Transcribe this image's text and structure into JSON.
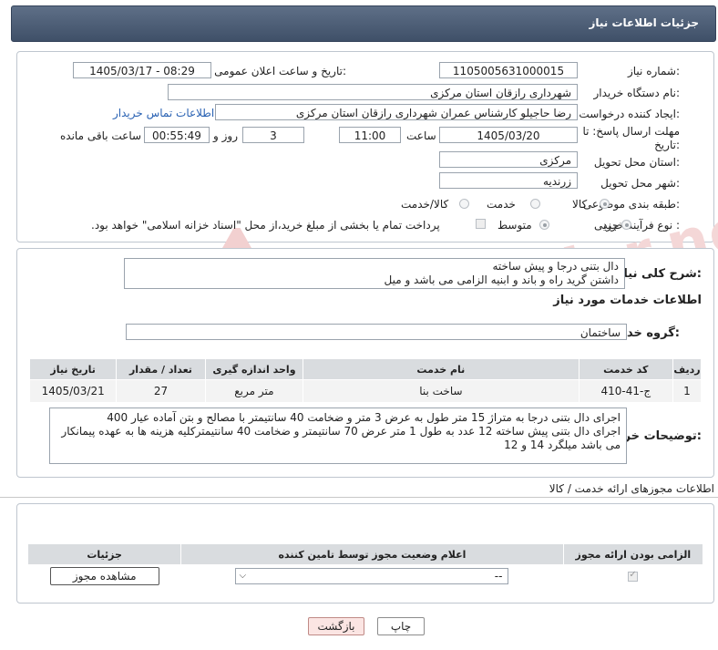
{
  "header": {
    "title": "جزئیات اطلاعات نیاز"
  },
  "form": {
    "need_number_label": "شماره نیاز:",
    "need_number": "1105005631000015",
    "announce_label": "تاریخ و ساعت اعلان عمومی:",
    "announce_value": "1405/03/17 - 08:29",
    "buyer_org_label": "نام دستگاه خریدار:",
    "buyer_org": "شهرداری رازقان استان مرکزی",
    "creator_label": "ایجاد کننده درخواست:",
    "creator": "رضا حاجیلو کارشناس عمران شهرداری رازقان استان مرکزی",
    "contact_link": "اطلاعات تماس خریدار",
    "deadline_label_1": "مهلت ارسال پاسخ: تا",
    "deadline_label_2": "تاریخ:",
    "deadline_date": "1405/03/20",
    "time_label": "ساعت",
    "deadline_time": "11:00",
    "days_value": "3",
    "days_label": "روز و",
    "remaining_value": "00:55:49",
    "remaining_label": "ساعت باقی مانده",
    "province_label": "استان محل تحویل:",
    "province": "مرکزی",
    "city_label": "شهر محل تحویل:",
    "city": "زرندیه",
    "category_label": "طبقه بندی موضوعی:",
    "category_options": [
      "کالا",
      "خدمت",
      "کالا/خدمت"
    ],
    "category_selected": "کالا",
    "process_label": "نوع فرآیند خرید :",
    "process_options": [
      "جزیی",
      "متوسط"
    ],
    "process_selected": "جزیی",
    "payment_note": "پرداخت تمام یا بخشی از مبلغ خرید،از محل \"اسناد خزانه اسلامی\" خواهد بود."
  },
  "summary": {
    "label": "شرح کلی نیاز:",
    "line1": "دال بتنی درجا و پیش ساخته",
    "line2": "داشتن گرید راه و باند و ابنیه الزامی می باشد و میل"
  },
  "services": {
    "section_title": "اطلاعات خدمات مورد نیاز",
    "group_label": "گروه خدمت:",
    "group_value": "ساختمان",
    "columns": [
      "ردیف",
      "کد خدمت",
      "نام خدمت",
      "واحد اندازه گیری",
      "تعداد / مقدار",
      "تاریخ نیاز"
    ],
    "rows": [
      {
        "row": "1",
        "code": "ج-41-410",
        "name": "ساخت بنا",
        "unit": "متر مربع",
        "qty": "27",
        "date": "1405/03/21"
      }
    ]
  },
  "buyer_notes": {
    "label": "توضیحات خریدار:",
    "line1": "اجرای دال بتنی درجا به متراژ 15 متر طول به عرض 3 متر و ضخامت 40 سانتیمتر با مصالح و بتن آماده عیار 400",
    "line2": "اجرای دال بتنی پیش ساخته 12 عدد به طول 1 متر عرض 70 سانتیمتر و ضخامت 40 سانتیمترکلیه هزینه ها به عهده پیمانکار",
    "line3": "می باشد میلگرد 14 و 12"
  },
  "permits": {
    "section_title": "اطلاعات مجوزهای ارائه خدمت / کالا",
    "columns": [
      "الزامی بودن ارائه مجوز",
      "اعلام وضعیت مجوز توسط تامین کننده",
      "جزئیات"
    ],
    "select_value": "--",
    "view_button": "مشاهده مجوز"
  },
  "footer": {
    "print_button": "چاپ",
    "back_button": "بازگشت"
  },
  "watermark": "AriaTender.net"
}
